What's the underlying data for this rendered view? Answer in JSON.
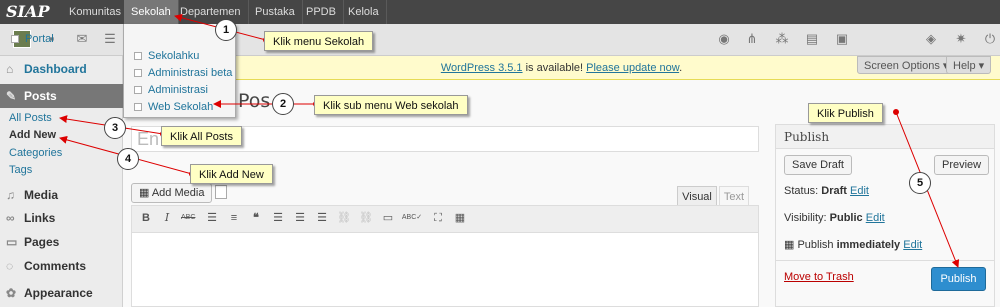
{
  "topbar": {
    "logo": "SIAP",
    "nav": [
      "Komunitas",
      "Sekolah",
      "Departemen",
      "Pustaka",
      "PPDB",
      "Kelola"
    ]
  },
  "dropdown": {
    "items": [
      "Portal",
      "Sekolahku",
      "Administrasi beta",
      "Administrasi",
      "Web Sekolah"
    ]
  },
  "notice": {
    "prefix": "WordPress 3.5.1",
    "middle": " is available! ",
    "link": "Please update now",
    "suffix": "."
  },
  "screen_options": "Screen Options ▾",
  "help": "Help ▾",
  "sidebar": {
    "dashboard": "Dashboard",
    "posts": "Posts",
    "sub": [
      "All Posts",
      "Add New",
      "Categories",
      "Tags"
    ],
    "media": "Media",
    "links": "Links",
    "pages": "Pages",
    "comments": "Comments",
    "appearance": "Appearance"
  },
  "page_title_partial": "Pos",
  "title_placeholder_partial": "En",
  "editor": {
    "add_media": "Add Media",
    "tab_visual": "Visual",
    "tab_text": "Text"
  },
  "publish_box": {
    "title": "Publish",
    "save_draft": "Save Draft",
    "preview": "Preview",
    "status_label": "Status: ",
    "status_value": "Draft",
    "visibility_label": "Visibility: ",
    "visibility_value": "Public",
    "publish_label": "Publish ",
    "publish_value": "immediately",
    "edit": "Edit",
    "trash": "Move to Trash",
    "publish_button": "Publish"
  },
  "callouts": [
    {
      "num": "1",
      "text": "Klik menu Sekolah"
    },
    {
      "num": "2",
      "text": "Klik sub menu Web sekolah"
    },
    {
      "num": "3",
      "text": "Klik All Posts"
    },
    {
      "num": "4",
      "text": "Klik Add New"
    },
    {
      "num": "5",
      "text": "Klik Publish"
    }
  ]
}
